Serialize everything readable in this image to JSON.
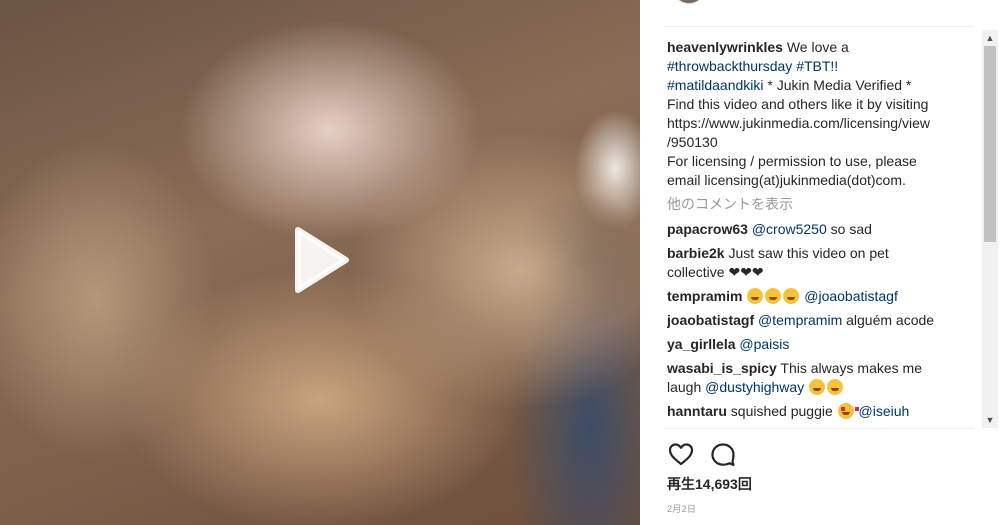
{
  "post": {
    "username": "heavenlywrinkles",
    "caption_lines": [
      "We love a",
      "#throwbackthursday",
      "#TBT!!",
      "#matildaandkiki",
      "* Jukin Media Verified *",
      "Find this video and others like it by visiting",
      "https://www.jukinmedia.com/licensing/view",
      "/950130",
      "For licensing / permission to use, please",
      "email licensing(at)jukinmedia(dot)com."
    ],
    "load_more_comments": "他のコメントを表示",
    "views": "再生14,693回",
    "date": "2月2日"
  },
  "comments": [
    {
      "user": "papacrow63",
      "mention": "@crow5250",
      "text": "so sad"
    },
    {
      "user": "barbie2k",
      "line1": "Just saw this video on pet",
      "line2": "collective ❤❤❤"
    },
    {
      "user": "tempramim",
      "mention": "@joaobatistagf"
    },
    {
      "user": "joaobatistagf",
      "mention": "@tempramim",
      "text": "alguém acode"
    },
    {
      "user": "ya_girllela",
      "mention": "@paisis"
    },
    {
      "user": "wasabi_is_spicy",
      "line1": "This always makes me",
      "line2": "laugh",
      "mention": "@dustyhighway"
    },
    {
      "user": "hanntaru",
      "text": "squished puggie",
      "mention": "@iseiuh"
    }
  ],
  "icons": {
    "play": "play-icon",
    "like": "heart-outline-icon",
    "comment": "comment-bubble-icon",
    "laugh": "face-with-tears-of-joy-emoji",
    "heart_eyes": "heart-eyes-emoji"
  },
  "colors": {
    "link": "#003569",
    "text": "#262626",
    "muted": "#999999"
  }
}
